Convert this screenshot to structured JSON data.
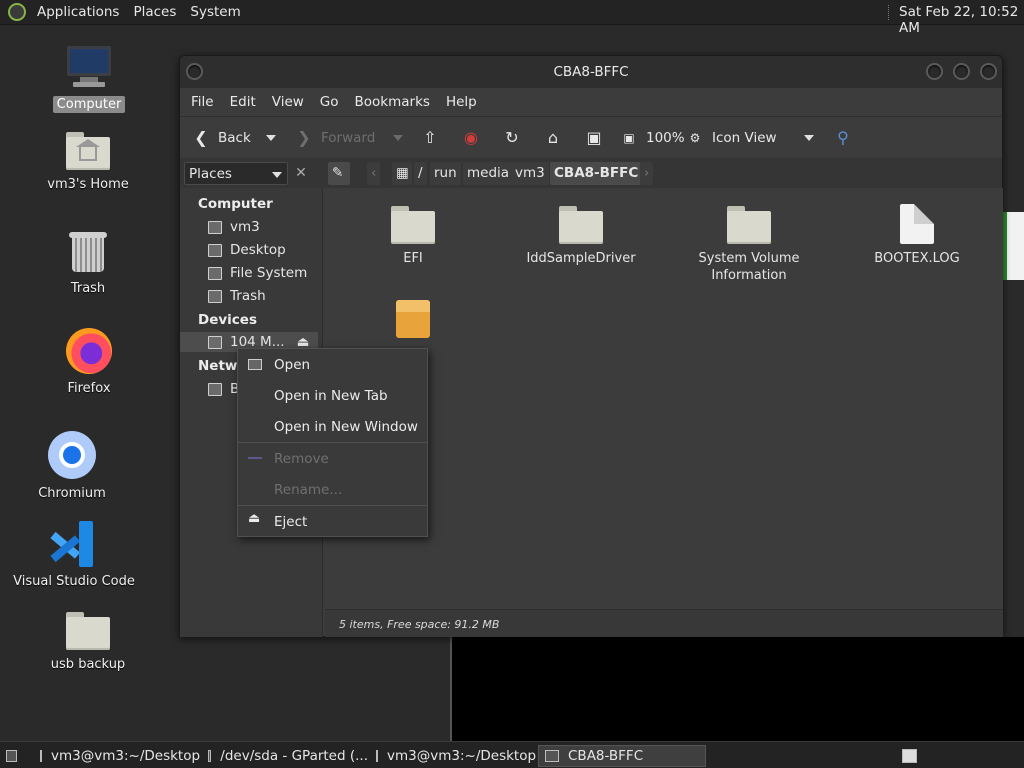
{
  "top_panel": {
    "menus": [
      "Applications",
      "Places",
      "System"
    ],
    "clock": "Sat Feb 22, 10:52 AM"
  },
  "desktop": {
    "icons": [
      {
        "label": "Computer",
        "icon": "computer-icon"
      },
      {
        "label": "vm3's Home",
        "icon": "home-folder-icon"
      },
      {
        "label": "Trash",
        "icon": "trash-icon"
      },
      {
        "label": "Firefox",
        "icon": "firefox-icon"
      },
      {
        "label": "Chromium",
        "icon": "chromium-icon"
      },
      {
        "label": "Visual Studio Code",
        "icon": "vscode-icon"
      },
      {
        "label": "usb backup",
        "icon": "folder-icon"
      }
    ]
  },
  "window": {
    "title": "CBA8-BFFC",
    "menubar": [
      "File",
      "Edit",
      "View",
      "Go",
      "Bookmarks",
      "Help"
    ],
    "toolbar": {
      "back": "Back",
      "forward": "Forward",
      "zoom": "100%",
      "view_mode": "Icon View"
    },
    "location": {
      "places_select": "Places",
      "path": [
        "/",
        "run",
        "media",
        "vm3",
        "CBA8-BFFC"
      ]
    },
    "sidebar": {
      "sections": [
        {
          "heading": "Computer",
          "items": [
            "vm3",
            "Desktop",
            "File System",
            "Trash"
          ]
        },
        {
          "heading": "Devices",
          "items": [
            "104 M..."
          ]
        },
        {
          "heading": "Netwo",
          "items": [
            "B"
          ]
        }
      ]
    },
    "files": [
      {
        "name": "EFI",
        "type": "folder"
      },
      {
        "name": "IddSampleDriver",
        "type": "folder"
      },
      {
        "name": "System Volume Information",
        "type": "folder"
      },
      {
        "name": "BOOTEX.LOG",
        "type": "document"
      },
      {
        "name": "",
        "type": "package"
      }
    ],
    "status": "5 items, Free space: 91.2 MB"
  },
  "context_menu": {
    "items": [
      {
        "label": "Open",
        "enabled": true
      },
      {
        "label": "Open in New Tab",
        "enabled": true
      },
      {
        "label": "Open in New Window",
        "enabled": true
      },
      {
        "label": "Remove",
        "enabled": false
      },
      {
        "label": "Rename...",
        "enabled": false
      },
      {
        "label": "Eject",
        "enabled": true
      }
    ]
  },
  "taskbar": {
    "tasks": [
      {
        "label": "vm3@vm3:~/Desktop",
        "active": false
      },
      {
        "label": "/dev/sda - GParted (...",
        "active": false
      },
      {
        "label": "vm3@vm3:~/Desktop",
        "active": false
      },
      {
        "label": "CBA8-BFFC",
        "active": true
      }
    ]
  }
}
